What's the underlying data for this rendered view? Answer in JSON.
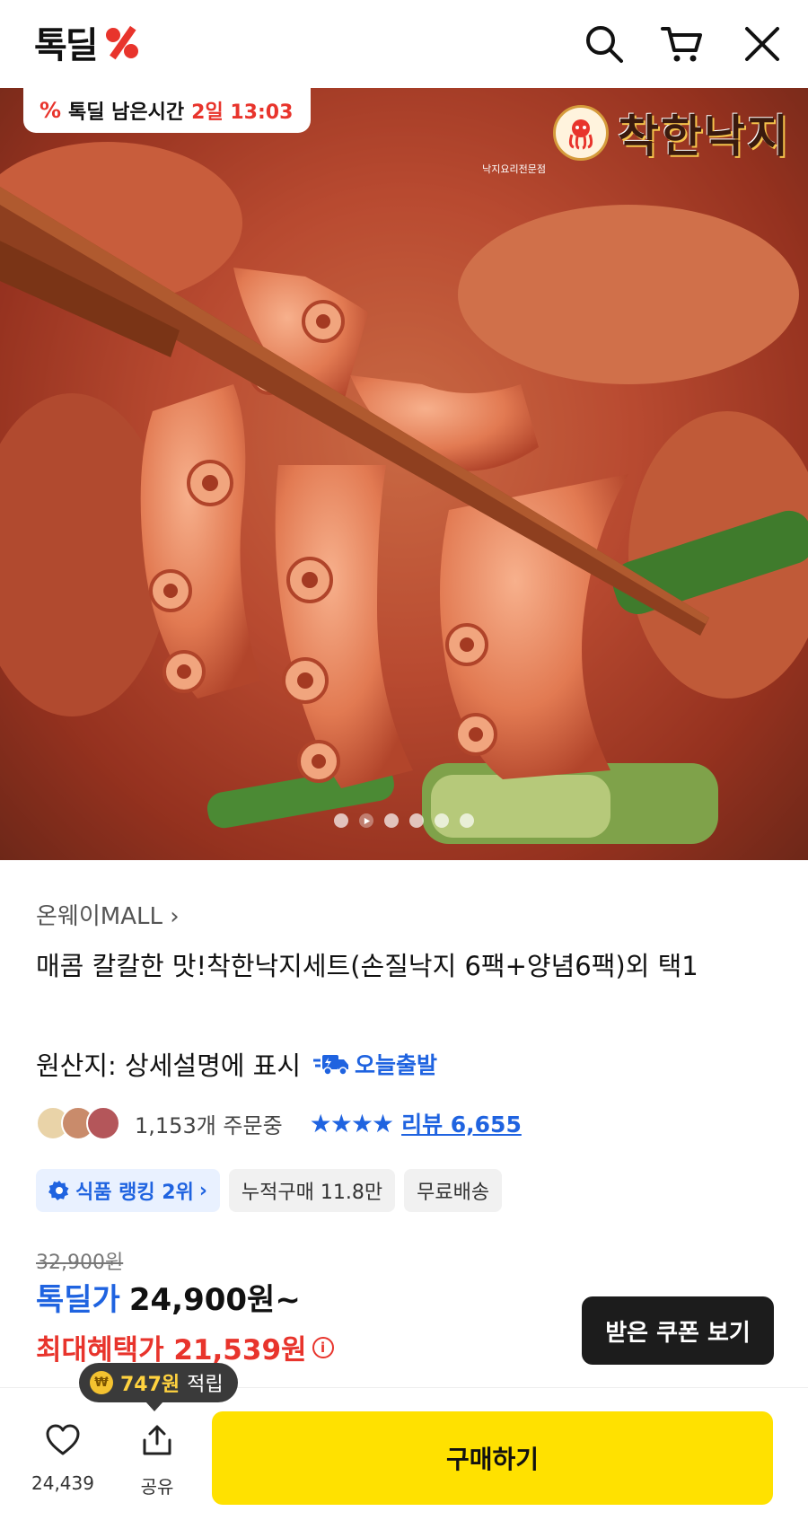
{
  "header": {
    "logo_text": "톡딜",
    "icons": [
      "search-icon",
      "cart-icon",
      "close-icon"
    ]
  },
  "hero": {
    "timer_label": "톡딜 남은시간",
    "timer_value": "2일 13:03",
    "brand_name": "착한낙지",
    "brand_sub": "낙지요리전문점",
    "slides": 6,
    "active_slide": 1
  },
  "product": {
    "seller": "온웨이MALL",
    "title": "매콤 칼칼한 맛!착한낙지세트(손질낙지 6팩+양념6팩)외 택1",
    "origin": "원산지: 상세설명에 표시",
    "shipping_badge": "오늘출발",
    "orders": "1,153개 주문중",
    "rating_stars": 4,
    "review_link": "리뷰 6,655",
    "tags": [
      "식품 랭킹 2위",
      "누적구매 11.8만",
      "무료배송"
    ],
    "original_price": "32,900원",
    "deal_label": "톡딜가",
    "deal_price": "24,900원~",
    "max_benefit": "최대혜택가 21,539원",
    "coupon_button": "받은 쿠폰 보기"
  },
  "bottom_bar": {
    "points_amount": "747원",
    "points_suffix": "적립",
    "like_count": "24,439",
    "share_label": "공유",
    "buy_button": "구매하기"
  },
  "colors": {
    "accent_blue": "#1f63e0",
    "deal_red": "#e8342c",
    "buy_yellow": "#ffe100"
  }
}
